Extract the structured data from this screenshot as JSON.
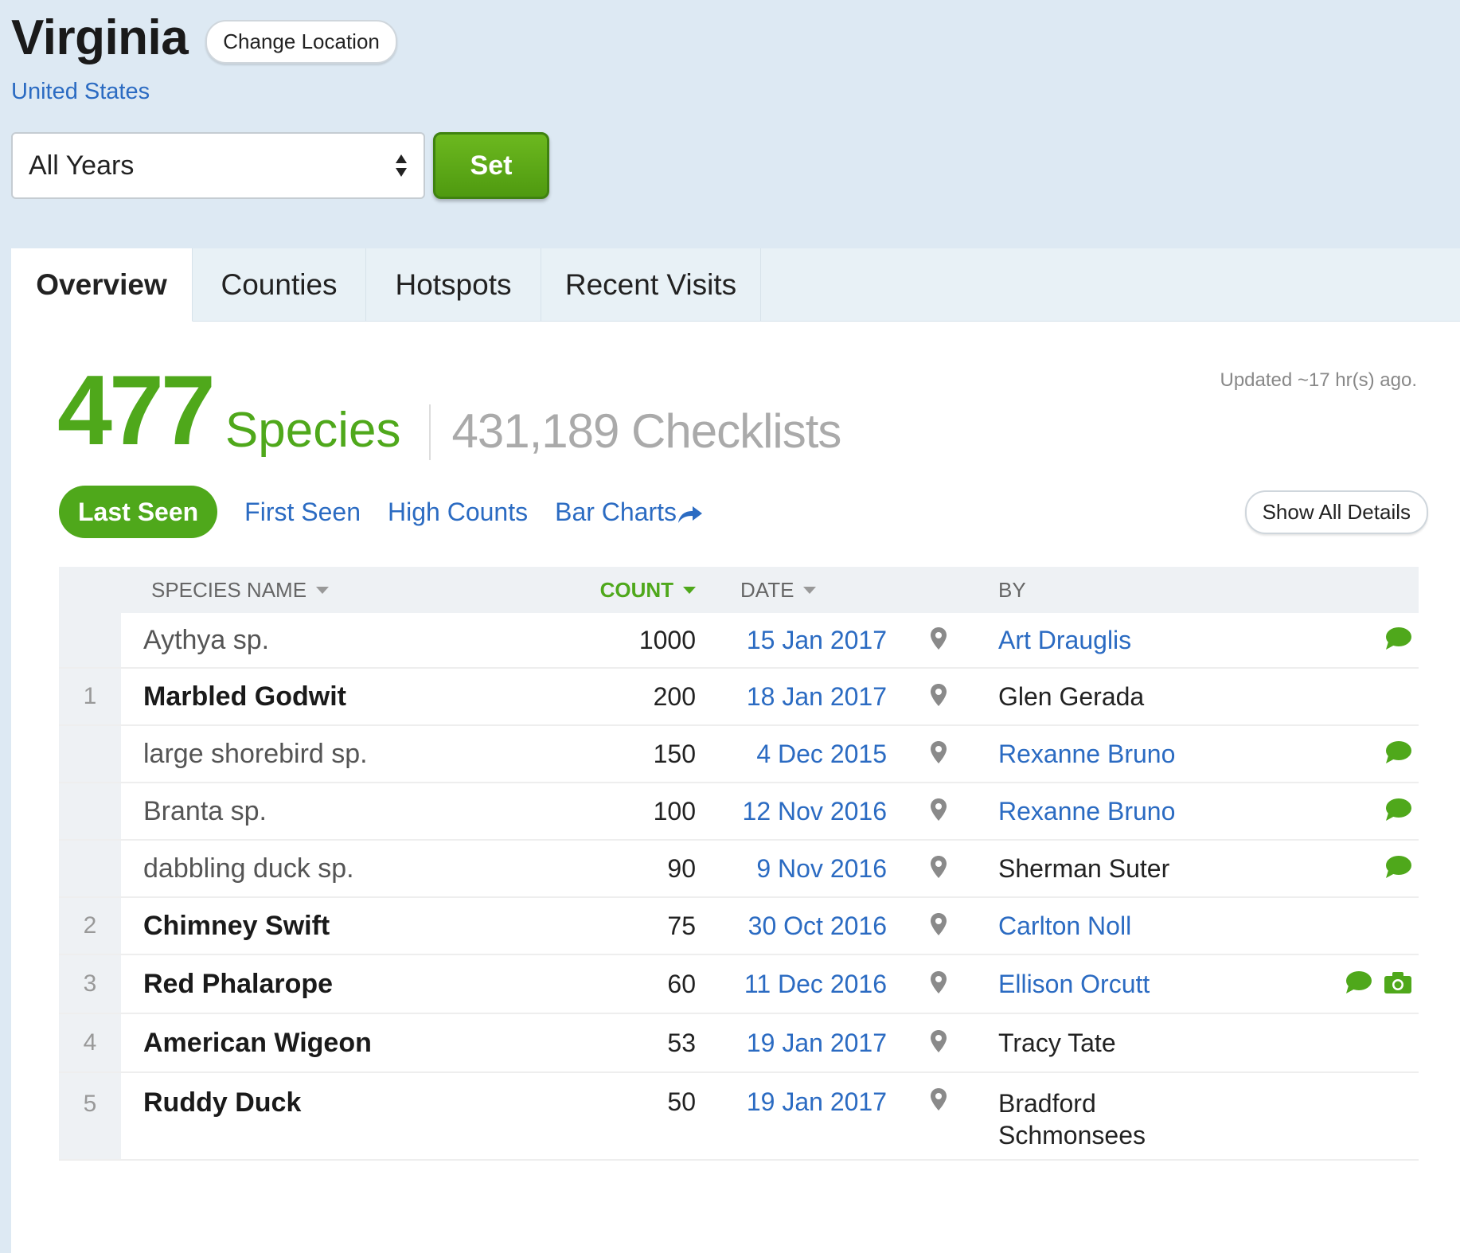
{
  "location": {
    "title": "Virginia",
    "change_label": "Change Location",
    "country": "United States"
  },
  "year_filter": {
    "selected": "All Years",
    "set_label": "Set"
  },
  "tabs": [
    {
      "label": "Overview",
      "active": true
    },
    {
      "label": "Counties",
      "active": false
    },
    {
      "label": "Hotspots",
      "active": false
    },
    {
      "label": "Recent Visits",
      "active": false
    }
  ],
  "stats": {
    "species_count": "477",
    "species_label": "Species",
    "checklists": "431,189 Checklists",
    "updated": "Updated ~17 hr(s) ago."
  },
  "views": {
    "last_seen": "Last Seen",
    "first_seen": "First Seen",
    "high_counts": "High Counts",
    "bar_charts": "Bar Charts",
    "show_all_details": "Show All Details"
  },
  "table": {
    "headers": {
      "species": "SPECIES NAME",
      "count": "COUNT",
      "date": "DATE",
      "by": "BY"
    },
    "rows": [
      {
        "rank": "",
        "name": "Aythya sp.",
        "bold": false,
        "count": "1000",
        "date": "15 Jan 2017",
        "by": "Art Drauglis",
        "by_link": true,
        "comment": true,
        "photo": false
      },
      {
        "rank": "1",
        "name": "Marbled Godwit",
        "bold": true,
        "count": "200",
        "date": "18 Jan 2017",
        "by": "Glen Gerada",
        "by_link": false,
        "comment": false,
        "photo": false
      },
      {
        "rank": "",
        "name": "large shorebird sp.",
        "bold": false,
        "count": "150",
        "date": "4 Dec 2015",
        "by": "Rexanne Bruno",
        "by_link": true,
        "comment": true,
        "photo": false
      },
      {
        "rank": "",
        "name": "Branta sp.",
        "bold": false,
        "count": "100",
        "date": "12 Nov 2016",
        "by": "Rexanne Bruno",
        "by_link": true,
        "comment": true,
        "photo": false
      },
      {
        "rank": "",
        "name": "dabbling duck sp.",
        "bold": false,
        "count": "90",
        "date": "9 Nov 2016",
        "by": "Sherman Suter",
        "by_link": false,
        "comment": true,
        "photo": false
      },
      {
        "rank": "2",
        "name": "Chimney Swift",
        "bold": true,
        "count": "75",
        "date": "30 Oct 2016",
        "by": "Carlton Noll",
        "by_link": true,
        "comment": false,
        "photo": false
      },
      {
        "rank": "3",
        "name": "Red Phalarope",
        "bold": true,
        "count": "60",
        "date": "11 Dec 2016",
        "by": "Ellison Orcutt",
        "by_link": true,
        "comment": true,
        "photo": true
      },
      {
        "rank": "4",
        "name": "American Wigeon",
        "bold": true,
        "count": "53",
        "date": "19 Jan 2017",
        "by": "Tracy Tate",
        "by_link": false,
        "comment": false,
        "photo": false
      },
      {
        "rank": "5",
        "name": "Ruddy Duck",
        "bold": true,
        "count": "50",
        "date": "19 Jan 2017",
        "by": "Bradford Schmonsees",
        "by_link": false,
        "comment": false,
        "photo": false
      }
    ]
  },
  "colors": {
    "accent_green": "#4fa81b",
    "link_blue": "#2b6bc2",
    "header_bg": "#dde9f3"
  }
}
